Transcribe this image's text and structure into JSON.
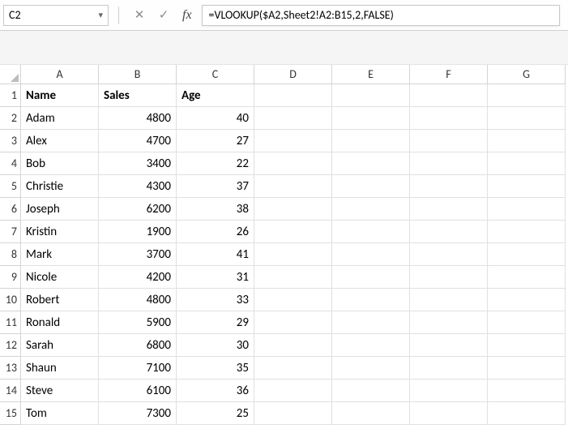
{
  "namebox": {
    "value": "C2"
  },
  "formula_bar": {
    "cancel_glyph": "✕",
    "confirm_glyph": "✓",
    "fx_label": "fx",
    "formula": "=VLOOKUP($A2,Sheet2!A2:B15,2,FALSE)"
  },
  "columns": [
    "A",
    "B",
    "C",
    "D",
    "E",
    "F",
    "G"
  ],
  "row_numbers": [
    1,
    2,
    3,
    4,
    5,
    6,
    7,
    8,
    9,
    10,
    11,
    12,
    13,
    14,
    15
  ],
  "header_row": {
    "name": "Name",
    "sales": "Sales",
    "age": "Age"
  },
  "rows": [
    {
      "name": "Adam",
      "sales": 4800,
      "age": 40
    },
    {
      "name": "Alex",
      "sales": 4700,
      "age": 27
    },
    {
      "name": "Bob",
      "sales": 3400,
      "age": 22
    },
    {
      "name": "Christie",
      "sales": 4300,
      "age": 37
    },
    {
      "name": "Joseph",
      "sales": 6200,
      "age": 38
    },
    {
      "name": "Kristin",
      "sales": 1900,
      "age": 26
    },
    {
      "name": "Mark",
      "sales": 3700,
      "age": 41
    },
    {
      "name": "Nicole",
      "sales": 4200,
      "age": 31
    },
    {
      "name": "Robert",
      "sales": 4800,
      "age": 33
    },
    {
      "name": "Ronald",
      "sales": 5900,
      "age": 29
    },
    {
      "name": "Sarah",
      "sales": 6800,
      "age": 30
    },
    {
      "name": "Shaun",
      "sales": 7100,
      "age": 35
    },
    {
      "name": "Steve",
      "sales": 6100,
      "age": 36
    },
    {
      "name": "Tom",
      "sales": 7300,
      "age": 25
    }
  ]
}
